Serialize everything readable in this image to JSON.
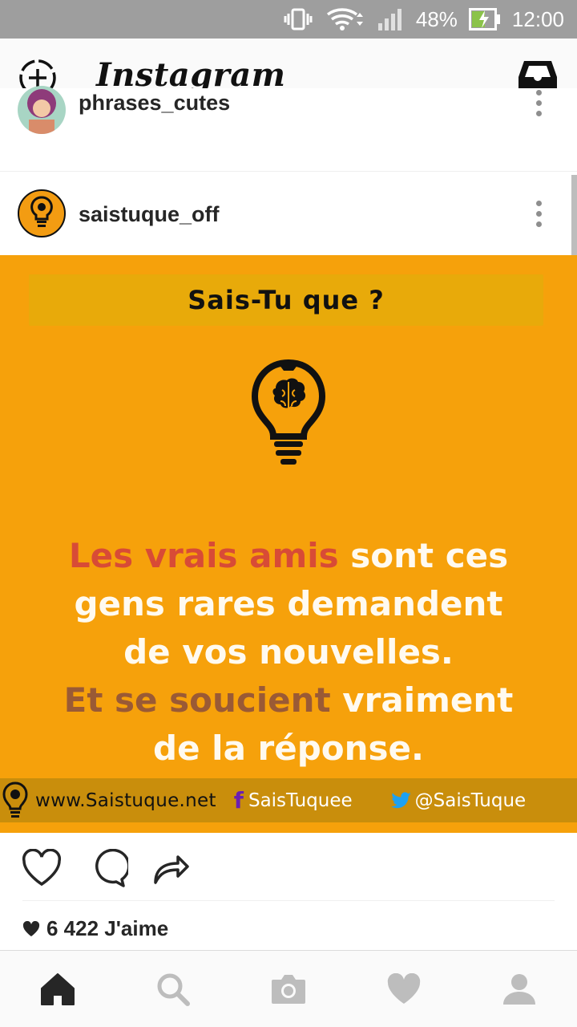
{
  "status_bar": {
    "battery": "48%",
    "time": "12:00"
  },
  "app": {
    "title": "Instagram",
    "new_post_icon": "add-story-icon",
    "inbox_icon": "inbox-icon"
  },
  "posts": [
    {
      "username": "phrases_cutes"
    },
    {
      "username": "saistuque_off"
    }
  ],
  "post_image": {
    "banner": "Sais-Tu que ?",
    "quote": {
      "line1_red": "Les vrais amis",
      "line1_rest": " sont ces",
      "line2": "gens rares demandent",
      "line3": "de vos nouvelles.",
      "line4_brown": "Et se soucient",
      "line4_rest": " vraiment",
      "line5": "de la réponse."
    },
    "footer": {
      "website": "www.Saistuque.net",
      "facebook": "SaisTuquee",
      "twitter": "@SaisTuque"
    },
    "colors": {
      "background": "#f6a10b",
      "highlight_red": "#d84b36",
      "highlight_brown": "#9a5a35"
    }
  },
  "likes": "6 422 J'aime",
  "bottom_nav": [
    "home-icon",
    "search-icon",
    "camera-icon",
    "heart-icon",
    "profile-icon"
  ]
}
